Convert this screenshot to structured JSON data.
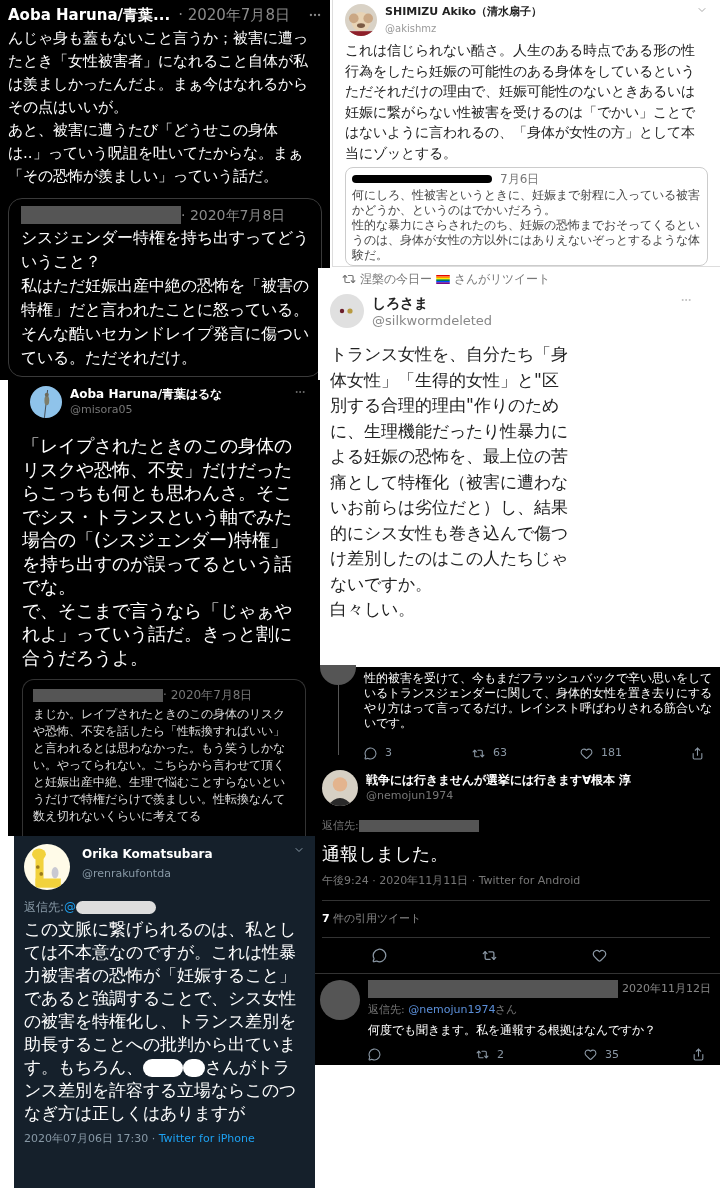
{
  "tweet_top_left": {
    "author": "Aoba Haruna/青葉...",
    "date": "· 2020年7月8日",
    "paragraphs": [
      "んじゃ身も蓋もないこと言うか；被害に遭ったとき「女性被害者」になれること自体が私は羨ましかったんだよ。まぁ今はなれるからその点はいいが。",
      "あと、被害に遭うたび「どうせこの身体は..」っていう呪詛を吐いてたからな。まぁ「その恐怖が羨ましい」っていう話だ。"
    ],
    "quote": {
      "date": "· 2020年7月8日",
      "paragraphs": [
        "シスジェンダー特権を持ち出すってどういうこと？",
        "私はただ妊娠出産中絶の恐怖を「被害の特権」だと言われたことに怒っている。そんな酷いセカンドレイプ発言に傷ついている。ただそれだけ。"
      ]
    }
  },
  "tweet_shimizu": {
    "author": "SHIMIZU Akiko（清水扇子）",
    "handle": "@akishmz",
    "text": "これは信じられない酷さ。人生のある時点である形の性行為をしたら妊娠の可能性のある身体をしているというただそれだけの理由で、妊娠可能性のないときあるいは妊娠に繋がらない性被害を受けるのは「でかい」ことではないように言われるの、「身体が女性の方」として本当にゾッとする。",
    "quote": {
      "date": "7月6日",
      "paragraphs": [
        "何にしろ、性被害というときに、妊娠まで射程に入っている被害かどうか、というのはでかいだろう。",
        "性的な暴力にさらされたのち、妊娠の恐怖までおそってくるというのは、身体が女性の方以外にはありえないぞっとするような体験だ。"
      ]
    }
  },
  "tweet_shirosama": {
    "retweeted_by": "涅槃の今日ー",
    "retweet_label": "さんがリツイート",
    "author": "しろさま",
    "handle": "@silkwormdeleted",
    "paragraphs": [
      "トランス女性を、自分たち「身体女性」「生得的女性」と\"区別する合理的理由\"作りのために、生理機能だったり性暴力による妊娠の恐怖を、最上位の苦痛として特権化（被害に遭わないお前らは劣位だと）し、結果的にシス女性も巻き込んで傷つけ差別したのはこの人たちじゃないですか。",
      "白々しい。"
    ]
  },
  "tweet_aoba": {
    "author": "Aoba Haruna/青葉はるな",
    "handle": "@misora05",
    "paragraphs": [
      "「レイプされたときのこの身体のリスクや恐怖、不安」だけだったらこっちも何とも思わんさ。そこでシス・トランスという軸でみた場合の「(シスジェンダー)特権」を持ち出すのが誤ってるという話でな。",
      "で、そこまで言うなら「じゃぁやれよ」っていう話だ。きっと割に合うだろうよ。"
    ],
    "quote": {
      "date": "· 2020年7月8日",
      "text": "まじか。レイプされたときのこの身体のリスクや恐怖、不安を話したら「性転換すればいい」と言われるとは思わなかった。もう笑うしかない。やってられない。こちらから言わせて頂くと妊娠出産中絶、生理で悩むことすらないというだけで特権だらけで羨ましい。性転換なんて数え切れないくらいに考えてる"
    }
  },
  "thread": {
    "parent": {
      "text": "性的被害を受けて、今もまだフラッシュバックで辛い思いをしているトランスジェンダーに関して、身体的女性を置き去りにするやり方はって言ってるだけ。レイシスト呼ばわりされる筋合いないです。",
      "replies": "3",
      "retweets": "63",
      "likes": "181"
    },
    "tweet": {
      "author": "戦争には行きませんが選挙には行きます∀根本 淳",
      "handle": "@nemojun1974",
      "reply_to_label": "返信先:",
      "text": "通報しました。",
      "timestamp": "午後9:24 · 2020年11月11日 · Twitter for Android",
      "quote_count": "7",
      "quote_label": "件の引用ツイート"
    },
    "reply": {
      "date": "2020年11月12日",
      "reply_to_label": "返信先:",
      "reply_to": "@nemojun1974",
      "reply_to_suffix": "さん",
      "text": "何度でも聞きます。私を通報する根拠はなんですか？",
      "retweets": "2",
      "likes": "35"
    }
  },
  "tweet_orika": {
    "author": "Orika Komatsubara",
    "handle": "@renrakufontda",
    "reply_to_label": "返信先:",
    "reply_to": "@",
    "text": "この文脈に繋げられるのは、私としては不本意なのですが。これは性暴力被害者の恐怖が「妊娠すること」であると強調することで、シス女性の被害を特権化し、トランス差別を助長することへの批判から出ています。もちろん、",
    "text_continued": "さんがトランス差別を許容する立場ならこのつなぎ方は正しくはありますが",
    "timestamp": "2020年07月06日 17:30 · ",
    "source": "Twitter for iPhone"
  }
}
